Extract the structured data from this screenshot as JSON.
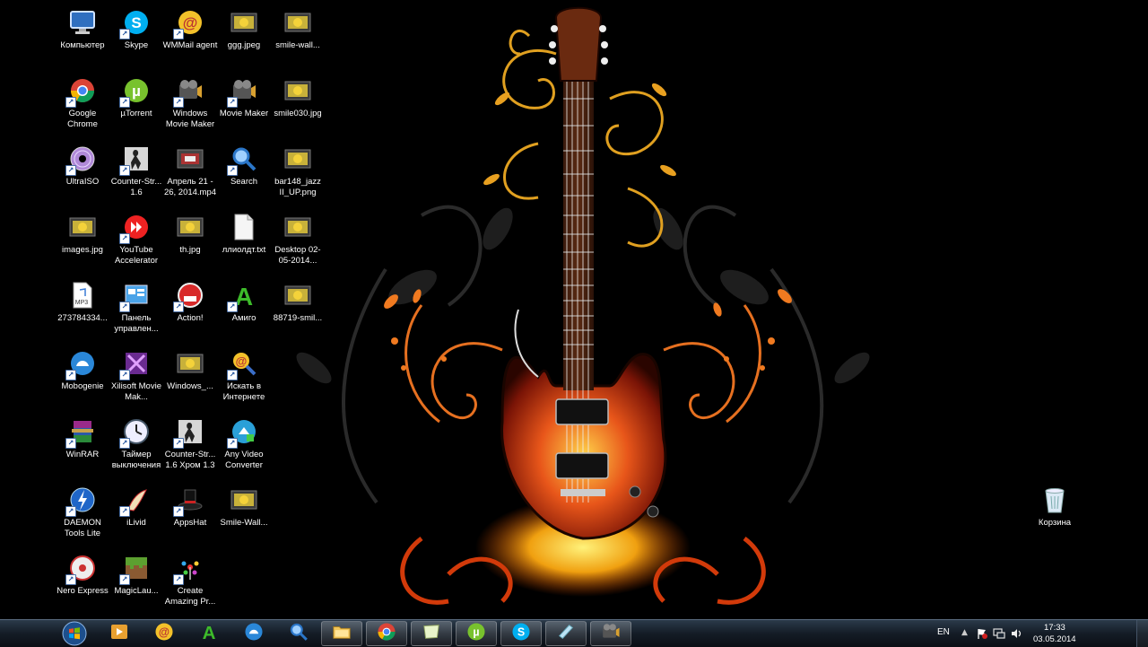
{
  "desktop": {
    "icons": [
      {
        "label": "Компьютер",
        "icon": "computer-icon",
        "shortcut": false
      },
      {
        "label": "Skype",
        "icon": "skype-icon",
        "shortcut": true
      },
      {
        "label": "WMMail agent",
        "icon": "wmmail-icon",
        "shortcut": true
      },
      {
        "label": "ggg.jpeg",
        "icon": "image-file-icon",
        "shortcut": false
      },
      {
        "label": "smile-wall...",
        "icon": "image-file-icon",
        "shortcut": false
      },
      {
        "label": "Google Chrome",
        "icon": "chrome-icon",
        "shortcut": true
      },
      {
        "label": "µTorrent",
        "icon": "utorrent-icon",
        "shortcut": true
      },
      {
        "label": "Windows Movie Maker",
        "icon": "movie-maker-icon",
        "shortcut": true
      },
      {
        "label": "Movie Maker",
        "icon": "movie-maker-icon",
        "shortcut": true
      },
      {
        "label": "smile030.jpg",
        "icon": "image-file-icon",
        "shortcut": false
      },
      {
        "label": "UltraISO",
        "icon": "ultraiso-icon",
        "shortcut": true
      },
      {
        "label": "Counter-Str... 1.6",
        "icon": "counter-strike-icon",
        "shortcut": true
      },
      {
        "label": "Апрель 21 - 26, 2014.mp4",
        "icon": "video-file-icon",
        "shortcut": false
      },
      {
        "label": "Search",
        "icon": "search-icon",
        "shortcut": true
      },
      {
        "label": "bar148_jazz II_UP.png",
        "icon": "image-file-icon",
        "shortcut": false
      },
      {
        "label": "images.jpg",
        "icon": "image-file-icon",
        "shortcut": false
      },
      {
        "label": "YouTube Accelerator",
        "icon": "youtube-accelerator-icon",
        "shortcut": true
      },
      {
        "label": "th.jpg",
        "icon": "image-file-icon",
        "shortcut": false
      },
      {
        "label": "ллиолдт.txt",
        "icon": "text-file-icon",
        "shortcut": false
      },
      {
        "label": "Desktop 02-05-2014...",
        "icon": "image-file-icon",
        "shortcut": false
      },
      {
        "label": "273784334...",
        "icon": "mp3-file-icon",
        "shortcut": false
      },
      {
        "label": "Панель управлен...",
        "icon": "control-panel-icon",
        "shortcut": true
      },
      {
        "label": "Action!",
        "icon": "action-icon",
        "shortcut": true
      },
      {
        "label": "Амиго",
        "icon": "amigo-icon",
        "shortcut": true
      },
      {
        "label": "88719-smil...",
        "icon": "image-file-icon",
        "shortcut": false
      },
      {
        "label": "Mobogenie",
        "icon": "mobogenie-icon",
        "shortcut": true
      },
      {
        "label": "Xilisoft Movie Mak...",
        "icon": "xilisoft-icon",
        "shortcut": true
      },
      {
        "label": "Windows_...",
        "icon": "image-file-icon",
        "shortcut": false
      },
      {
        "label": "Искать в Интернете",
        "icon": "internet-search-icon",
        "shortcut": true
      },
      {
        "label": "WinRAR",
        "icon": "winrar-icon",
        "shortcut": true
      },
      {
        "label": "Таймер выключения",
        "icon": "clock-icon",
        "shortcut": true
      },
      {
        "label": "Counter-Str... 1.6 Хром 1.3",
        "icon": "counter-strike-icon",
        "shortcut": true
      },
      {
        "label": "Any Video Converter",
        "icon": "video-converter-icon",
        "shortcut": true
      },
      {
        "label": "DAEMON Tools Lite",
        "icon": "daemon-tools-icon",
        "shortcut": true
      },
      {
        "label": "iLivid",
        "icon": "ilivid-icon",
        "shortcut": true
      },
      {
        "label": "AppsHat",
        "icon": "appshat-icon",
        "shortcut": true
      },
      {
        "label": "Smile-Wall...",
        "icon": "image-file-icon",
        "shortcut": false
      },
      {
        "label": "Nero Express",
        "icon": "nero-icon",
        "shortcut": true
      },
      {
        "label": "MagicLau...",
        "icon": "minecraft-icon",
        "shortcut": true
      },
      {
        "label": "Create Amazing Pr...",
        "icon": "create-icon",
        "shortcut": true
      },
      {
        "label": "Корзина",
        "icon": "recycle-bin-icon",
        "shortcut": false
      }
    ]
  },
  "taskbar": {
    "start_icon": "windows-start-icon",
    "pinned": [
      {
        "icon": "media-player-icon",
        "active": false
      },
      {
        "icon": "wmmail-icon",
        "active": false
      },
      {
        "icon": "amigo-icon",
        "active": false
      },
      {
        "icon": "mobogenie-icon",
        "active": false
      },
      {
        "icon": "search-icon",
        "active": false
      },
      {
        "icon": "explorer-folder-icon",
        "active": true
      },
      {
        "icon": "chrome-icon",
        "active": true
      },
      {
        "icon": "notes-icon",
        "active": true
      },
      {
        "icon": "utorrent-icon",
        "active": true
      },
      {
        "icon": "skype-icon",
        "active": true
      },
      {
        "icon": "sticky-app-icon",
        "active": true
      },
      {
        "icon": "movie-maker-icon",
        "active": true
      }
    ],
    "tray": {
      "language": "EN",
      "time": "17:33",
      "date": "03.05.2014"
    }
  }
}
